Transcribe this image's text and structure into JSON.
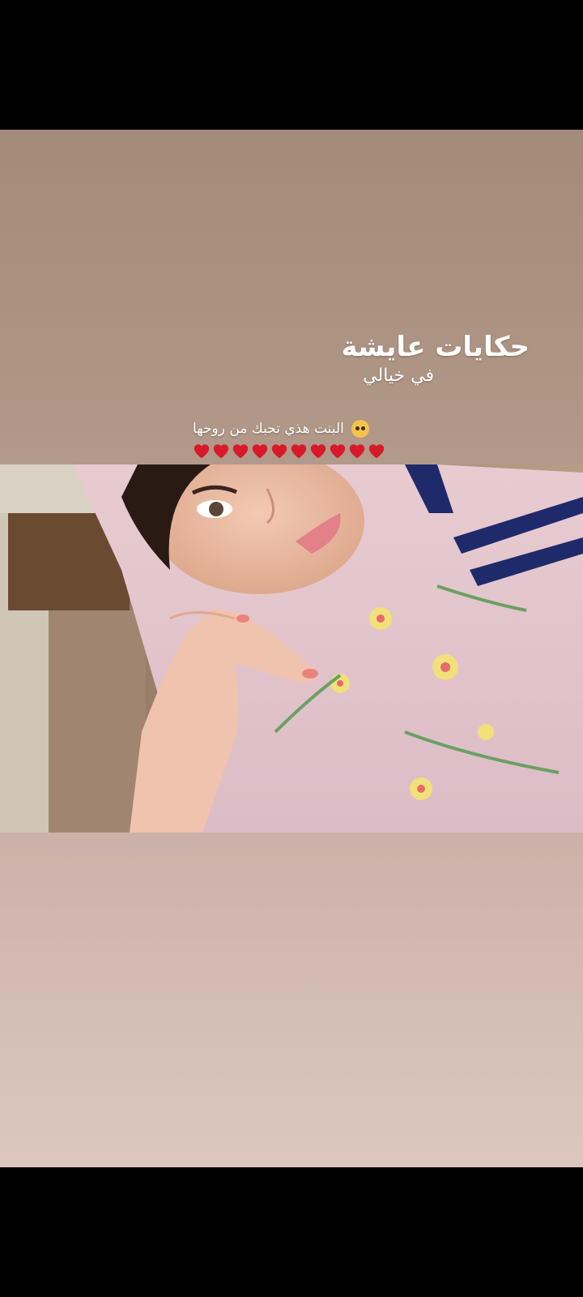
{
  "story": {
    "title": "حكايات عايشة",
    "subtitle": "في خيالي",
    "caption": "البنت هذي تحبك من روحها",
    "caption_emoji": "pleading-face-emoji",
    "hearts": [
      "❤",
      "❤",
      "❤",
      "❤",
      "❤",
      "❤",
      "❤",
      "❤",
      "❤",
      "❤"
    ],
    "photo_description_icon": "selfie-photo"
  },
  "colors": {
    "background_top": "#a48b79",
    "background_bottom": "#dcc7bf",
    "text": "#ffffff",
    "heart": "#d8192a",
    "scarf": "#e6c9cf",
    "scarf_stripe": "#1f2a6b"
  }
}
